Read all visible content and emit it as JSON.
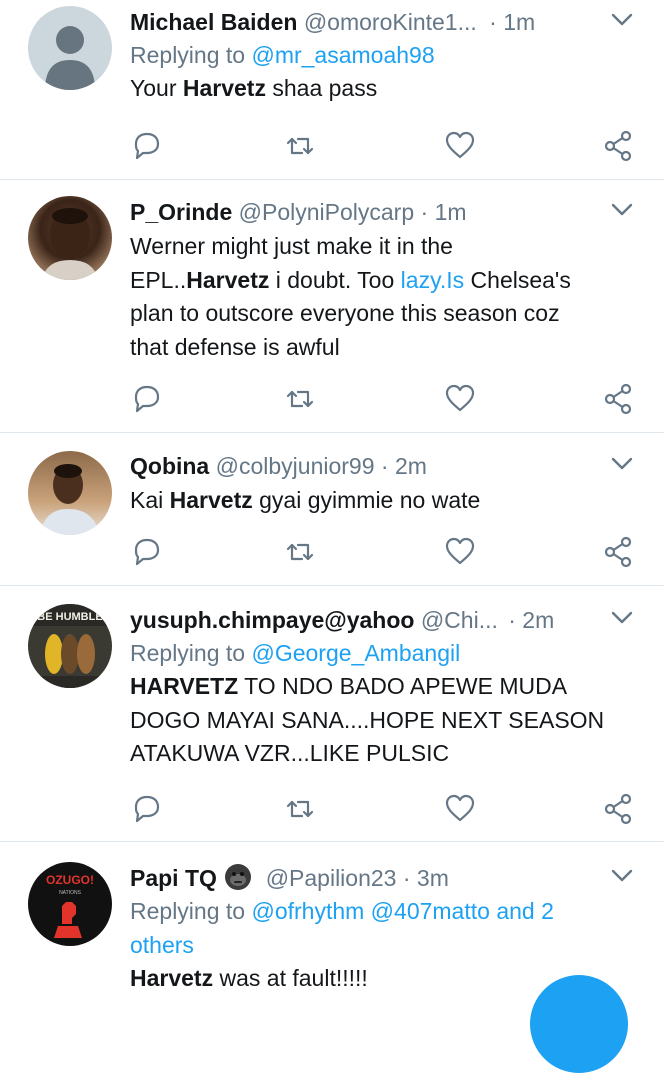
{
  "tweets": [
    {
      "name": "Michael Baiden",
      "handle": "@omoroKinte1...",
      "time": "· 1m",
      "reply_prefix": "Replying to",
      "reply_to": "@mr_asamoah98",
      "text_parts": [
        "Your ",
        "Harvetz",
        " shaa pass"
      ]
    },
    {
      "name": "P_Orinde",
      "handle": "@PolyniPolycarp",
      "time": "· 1m",
      "lines": [
        [
          "Werner might just make it in the"
        ],
        [
          "EPL..",
          "Harvetz",
          " i doubt. Too ",
          "lazy.Is",
          " Chelsea's"
        ],
        [
          "plan to outscore everyone this season coz"
        ],
        [
          "that defense is awful"
        ]
      ]
    },
    {
      "name": "Qobina",
      "handle": "@colbyjunior99",
      "time": "· 2m",
      "text_parts": [
        "Kai ",
        "Harvetz",
        " gyai gyimmie no wate"
      ]
    },
    {
      "name": "yusuph.chimpaye@yahoo",
      "handle": "@Chi...",
      "time": "· 2m",
      "reply_prefix": "Replying to",
      "reply_to": "@George_Ambangil",
      "avatar_text": "BE HUMBLE",
      "lines": [
        [
          "HARVETZ",
          " TO NDO BADO APEWE MUDA"
        ],
        [
          "DOGO MAYAI SANA....HOPE NEXT SEASON"
        ],
        [
          "ATAKUWA VZR...LIKE PULSIC"
        ]
      ]
    },
    {
      "name": "Papi TQ",
      "handle": "@Papilion23",
      "time": "· 3m",
      "reply_prefix": "Replying to",
      "reply_to_line1": "@ofrhythm @407matto and 2",
      "reply_to_line2": "others",
      "avatar_text": "OZUGO!",
      "avatar_subtext": "NATIONS",
      "text_parts": [
        "Harvetz",
        " was at fault!!!!!"
      ]
    }
  ],
  "colors": {
    "accent": "#1da1f2",
    "secondary": "#657786",
    "divider": "#e1e8ed"
  },
  "icons": [
    "reply-icon",
    "retweet-icon",
    "like-icon",
    "share-icon",
    "caret-down-icon",
    "gorilla-emoji-icon"
  ]
}
